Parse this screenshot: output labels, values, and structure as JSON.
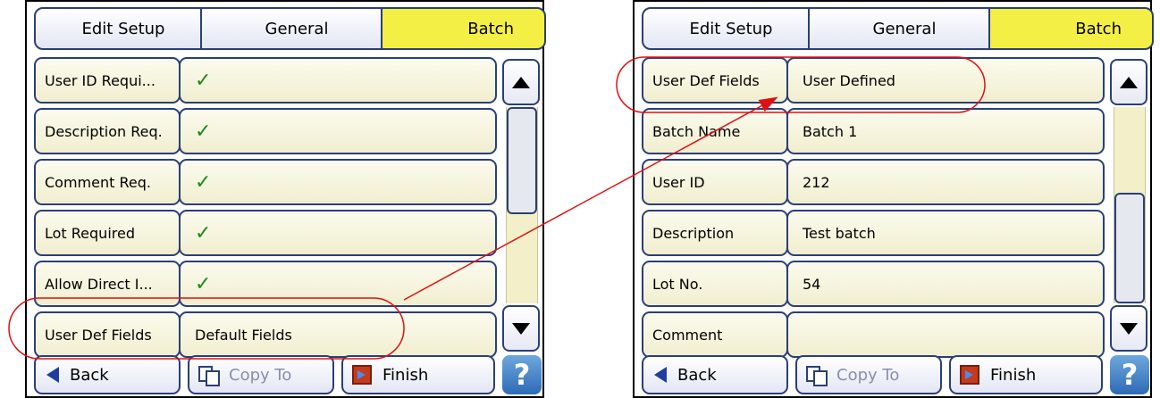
{
  "left_screen": {
    "breadcrumbs": [
      "Edit Setup",
      "General",
      "Batch"
    ],
    "rows": [
      {
        "label": "User ID Requi...",
        "value": "✓",
        "is_check": true
      },
      {
        "label": "Description Req.",
        "value": "✓",
        "is_check": true
      },
      {
        "label": "Comment Req.",
        "value": "✓",
        "is_check": true
      },
      {
        "label": "Lot Required",
        "value": "✓",
        "is_check": true
      },
      {
        "label": "Allow Direct I...",
        "value": "✓",
        "is_check": true
      },
      {
        "label": "User Def Fields",
        "value": "Default Fields",
        "is_check": false
      }
    ],
    "buttons": {
      "back": "Back",
      "copy_to": "Copy To",
      "finish": "Finish",
      "help": "?"
    }
  },
  "right_screen": {
    "breadcrumbs": [
      "Edit Setup",
      "General",
      "Batch"
    ],
    "rows": [
      {
        "label": "User Def Fields",
        "value": "User Defined"
      },
      {
        "label": "Batch Name",
        "value": "Batch 1"
      },
      {
        "label": "User ID",
        "value": "212"
      },
      {
        "label": "Description",
        "value": "Test batch"
      },
      {
        "label": "Lot No.",
        "value": "54"
      },
      {
        "label": "Comment",
        "value": ""
      }
    ],
    "buttons": {
      "back": "Back",
      "copy_to": "Copy To",
      "finish": "Finish",
      "help": "?"
    }
  },
  "colors": {
    "accent_yellow": "#f4ef45",
    "border_blue": "#2a3f78",
    "check_green": "#1a8a1a",
    "annotation_red": "#e01010",
    "help_blue": "#2d6bb4"
  },
  "icons": {
    "scroll_up": "triangle-up-icon",
    "scroll_down": "triangle-down-icon",
    "back": "left-arrow-icon",
    "copy": "copy-icon",
    "finish": "finish-icon",
    "help": "question-icon"
  }
}
